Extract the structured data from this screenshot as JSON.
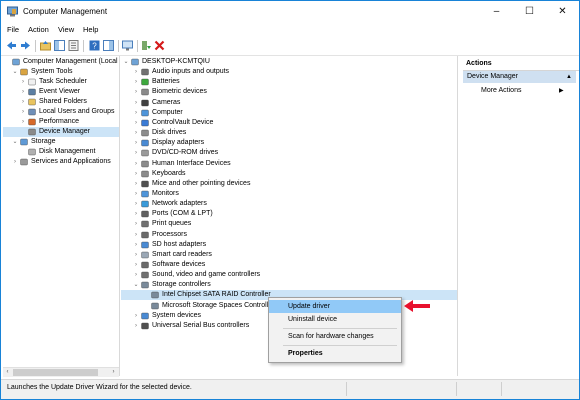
{
  "window": {
    "title": "Computer Management",
    "min": "–",
    "max": "☐",
    "close": "✕"
  },
  "menu": [
    "File",
    "Action",
    "View",
    "Help"
  ],
  "left_tree": [
    {
      "label": "Computer Management (Local",
      "chev": "",
      "indent": 0,
      "icon": "computer-management-icon"
    },
    {
      "label": "System Tools",
      "chev": "⌄",
      "indent": 1,
      "icon": "tools-icon"
    },
    {
      "label": "Task Scheduler",
      "chev": "›",
      "indent": 2,
      "icon": "clock-icon"
    },
    {
      "label": "Event Viewer",
      "chev": "›",
      "indent": 2,
      "icon": "event-viewer-icon"
    },
    {
      "label": "Shared Folders",
      "chev": "›",
      "indent": 2,
      "icon": "shared-folder-icon"
    },
    {
      "label": "Local Users and Groups",
      "chev": "›",
      "indent": 2,
      "icon": "users-icon"
    },
    {
      "label": "Performance",
      "chev": "›",
      "indent": 2,
      "icon": "performance-icon"
    },
    {
      "label": "Device Manager",
      "chev": "",
      "indent": 2,
      "icon": "device-manager-icon",
      "selected": true
    },
    {
      "label": "Storage",
      "chev": "⌄",
      "indent": 1,
      "icon": "storage-icon"
    },
    {
      "label": "Disk Management",
      "chev": "",
      "indent": 2,
      "icon": "disk-icon"
    },
    {
      "label": "Services and Applications",
      "chev": "›",
      "indent": 1,
      "icon": "services-icon"
    }
  ],
  "device_tree": [
    {
      "label": "DESKTOP-KCMTQIU",
      "chev": "⌄",
      "indent": 0,
      "icon": "computer-icon"
    },
    {
      "label": "Audio inputs and outputs",
      "chev": "›",
      "indent": 1,
      "icon": "speaker-icon"
    },
    {
      "label": "Batteries",
      "chev": "›",
      "indent": 1,
      "icon": "battery-icon"
    },
    {
      "label": "Biometric devices",
      "chev": "›",
      "indent": 1,
      "icon": "biometric-icon"
    },
    {
      "label": "Cameras",
      "chev": "›",
      "indent": 1,
      "icon": "camera-icon"
    },
    {
      "label": "Computer",
      "chev": "›",
      "indent": 1,
      "icon": "monitor-icon"
    },
    {
      "label": "ControlVault Device",
      "chev": "›",
      "indent": 1,
      "icon": "controlvault-icon"
    },
    {
      "label": "Disk drives",
      "chev": "›",
      "indent": 1,
      "icon": "disk-drive-icon"
    },
    {
      "label": "Display adapters",
      "chev": "›",
      "indent": 1,
      "icon": "display-adapter-icon"
    },
    {
      "label": "DVD/CD-ROM drives",
      "chev": "›",
      "indent": 1,
      "icon": "dvd-icon"
    },
    {
      "label": "Human Interface Devices",
      "chev": "›",
      "indent": 1,
      "icon": "hid-icon"
    },
    {
      "label": "Keyboards",
      "chev": "›",
      "indent": 1,
      "icon": "keyboard-icon"
    },
    {
      "label": "Mice and other pointing devices",
      "chev": "›",
      "indent": 1,
      "icon": "mouse-icon"
    },
    {
      "label": "Monitors",
      "chev": "›",
      "indent": 1,
      "icon": "monitor-icon"
    },
    {
      "label": "Network adapters",
      "chev": "›",
      "indent": 1,
      "icon": "network-icon"
    },
    {
      "label": "Ports (COM & LPT)",
      "chev": "›",
      "indent": 1,
      "icon": "port-icon"
    },
    {
      "label": "Print queues",
      "chev": "›",
      "indent": 1,
      "icon": "printer-icon"
    },
    {
      "label": "Processors",
      "chev": "›",
      "indent": 1,
      "icon": "processor-icon"
    },
    {
      "label": "SD host adapters",
      "chev": "›",
      "indent": 1,
      "icon": "sd-card-icon"
    },
    {
      "label": "Smart card readers",
      "chev": "›",
      "indent": 1,
      "icon": "smart-card-icon"
    },
    {
      "label": "Software devices",
      "chev": "›",
      "indent": 1,
      "icon": "software-device-icon"
    },
    {
      "label": "Sound, video and game controllers",
      "chev": "›",
      "indent": 1,
      "icon": "sound-icon"
    },
    {
      "label": "Storage controllers",
      "chev": "⌄",
      "indent": 1,
      "icon": "storage-controller-icon"
    },
    {
      "label": "Intel Chipset SATA RAID Controller",
      "chev": "",
      "indent": 2,
      "icon": "storage-controller-icon",
      "selected": true
    },
    {
      "label": "Microsoft Storage Spaces Controll",
      "chev": "",
      "indent": 2,
      "icon": "storage-controller-icon"
    },
    {
      "label": "System devices",
      "chev": "›",
      "indent": 1,
      "icon": "system-device-icon"
    },
    {
      "label": "Universal Serial Bus controllers",
      "chev": "›",
      "indent": 1,
      "icon": "usb-icon"
    }
  ],
  "actions": {
    "header": "Actions",
    "selected": "Device Manager",
    "more": "More Actions"
  },
  "context_menu": [
    "Update driver",
    "Uninstall device",
    "Scan for hardware changes",
    "Properties"
  ],
  "status": {
    "text": "Launches the Update Driver Wizard for the selected device."
  },
  "colors": {
    "accent": "#1883d7",
    "selection": "#cce4f7",
    "menu_highlight": "#91c9f7",
    "arrow": "#e8112d"
  }
}
